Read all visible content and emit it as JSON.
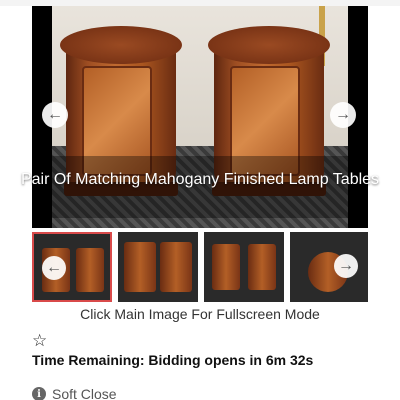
{
  "gallery": {
    "caption": "Pair Of Matching Mahogany Finished Lamp Tables",
    "prev_icon": "arrow-left",
    "next_icon": "arrow-right",
    "thumbnails": [
      {
        "active": true
      },
      {
        "active": false
      },
      {
        "active": false
      },
      {
        "active": false
      }
    ]
  },
  "fullscreen_hint": "Click Main Image For Fullscreen Mode",
  "watch_icon": "star-outline-icon",
  "time_remaining": "Time Remaining: Bidding opens in 6m 32s",
  "soft_close": {
    "icon": "info-icon",
    "label": "Soft Close"
  },
  "colors": {
    "active_thumb_border": "#d94a4a",
    "wood": "#b35f26"
  }
}
